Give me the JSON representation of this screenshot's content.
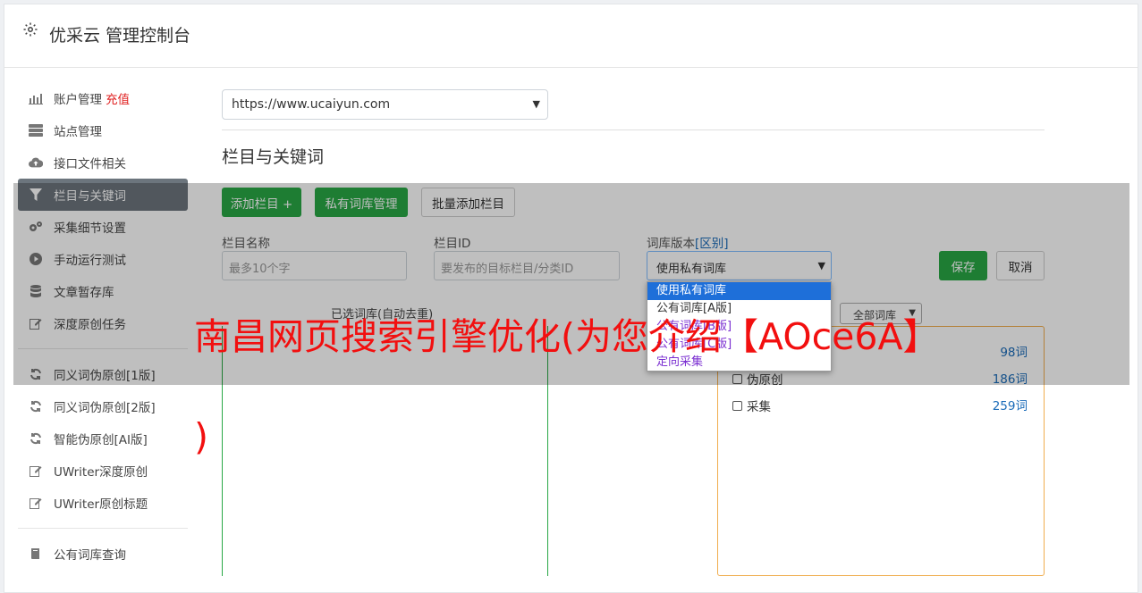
{
  "header": {
    "title": "优采云 管理控制台",
    "icon": "gear-icon"
  },
  "sidebar": {
    "items": [
      {
        "label": "账户管理",
        "extra": "充值",
        "icon": "bar-chart-icon"
      },
      {
        "label": "站点管理",
        "icon": "server-icon"
      },
      {
        "label": "接口文件相关",
        "icon": "cloud-upload-icon"
      },
      {
        "label": "栏目与关键词",
        "icon": "filter-icon",
        "active": true
      },
      {
        "label": "采集细节设置",
        "icon": "cogs-icon"
      },
      {
        "label": "手动运行测试",
        "icon": "play-circle-icon"
      },
      {
        "label": "文章暂存库",
        "icon": "database-icon"
      },
      {
        "label": "深度原创任务",
        "icon": "edit-icon"
      },
      {
        "label": "同义词伪原创[1版]",
        "icon": "refresh-icon"
      },
      {
        "label": "同义词伪原创[2版]",
        "icon": "refresh-icon"
      },
      {
        "label": "智能伪原创[AI版]",
        "icon": "refresh-icon"
      },
      {
        "label": "UWriter深度原创",
        "icon": "edit-icon"
      },
      {
        "label": "UWriter原创标题",
        "icon": "edit-icon"
      },
      {
        "label": "公有词库查询",
        "icon": "book-icon"
      }
    ]
  },
  "main": {
    "site_select": "https://www.ucaiyun.com",
    "section_title": "栏目与关键词",
    "buttons": {
      "add_column": "添加栏目 +",
      "private_lib": "私有词库管理",
      "batch_add": "批量添加栏目",
      "save": "保存",
      "cancel": "取消"
    },
    "form": {
      "column_name_label": "栏目名称",
      "column_name_placeholder": "最多10个字",
      "column_id_label": "栏目ID",
      "column_id_placeholder": "要发布的目标栏目/分类ID",
      "lib_version_label": "词库版本",
      "lib_version_link": "[区别]",
      "lib_version_value": "使用私有词库"
    },
    "dropdown_options": [
      "使用私有词库",
      "公有词库[A版]",
      "公有词库[B版]",
      "公有词库[C版]",
      "定向采集"
    ],
    "chosen_label": "已选词库(自动去重)",
    "lib_filter": "全部词库",
    "libraries": [
      {
        "name": "",
        "count": "98词"
      },
      {
        "name": "伪原创",
        "count": "186词"
      },
      {
        "name": "采集",
        "count": "259词"
      }
    ]
  },
  "promo": {
    "line1": "南昌网页搜索引擎优化(为您介绍【AOce6A】",
    "line2": ")"
  }
}
